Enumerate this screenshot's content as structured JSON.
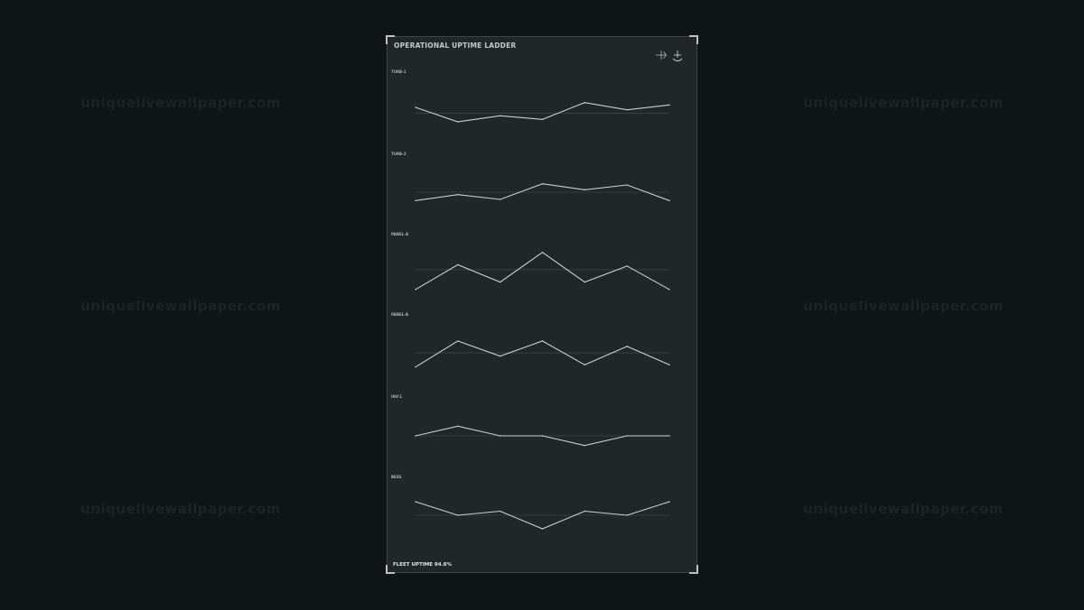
{
  "watermark": "uniquelivewallpaper.com",
  "colors": {
    "background": "#0f1415",
    "panel": "#212628",
    "line": "#c9cfd2",
    "baseline": "#4a5255",
    "watermark": "#1d2426"
  },
  "icons": [
    "crosshair-icon",
    "anchor-icon"
  ],
  "chart_data": {
    "type": "line",
    "title": "OPERATIONAL UPTIME LADDER",
    "footer": "FLEET UPTIME 94.8%",
    "layout": "stacked small multiples",
    "grid": false,
    "series": [
      {
        "name": "TURB-1",
        "values": [
          97,
          91,
          93.5,
          92,
          99,
          96,
          98
        ],
        "baseline": 94.5,
        "ylim": [
          88,
          103
        ]
      },
      {
        "name": "TURB-2",
        "values": [
          92,
          94.5,
          92.5,
          99,
          96.5,
          98.5,
          92
        ],
        "baseline": 95.5,
        "ylim": [
          88,
          103
        ]
      },
      {
        "name": "PANEL-A",
        "values": [
          87,
          97,
          90,
          102,
          90,
          96.5,
          87
        ],
        "baseline": 95,
        "ylim": [
          80,
          107
        ]
      },
      {
        "name": "PANEL-B",
        "values": [
          88,
          100,
          93,
          100,
          89,
          97.5,
          89
        ],
        "baseline": 94.5,
        "ylim": [
          80,
          107
        ]
      },
      {
        "name": "INV-1",
        "values": [
          95,
          99,
          95,
          95,
          91,
          95,
          95
        ],
        "baseline": 95,
        "ylim": [
          86,
          104
        ]
      },
      {
        "name": "BESS",
        "values": [
          99,
          94,
          95.5,
          89,
          95.5,
          94,
          99
        ],
        "baseline": 94,
        "ylim": [
          84,
          104
        ]
      }
    ]
  }
}
